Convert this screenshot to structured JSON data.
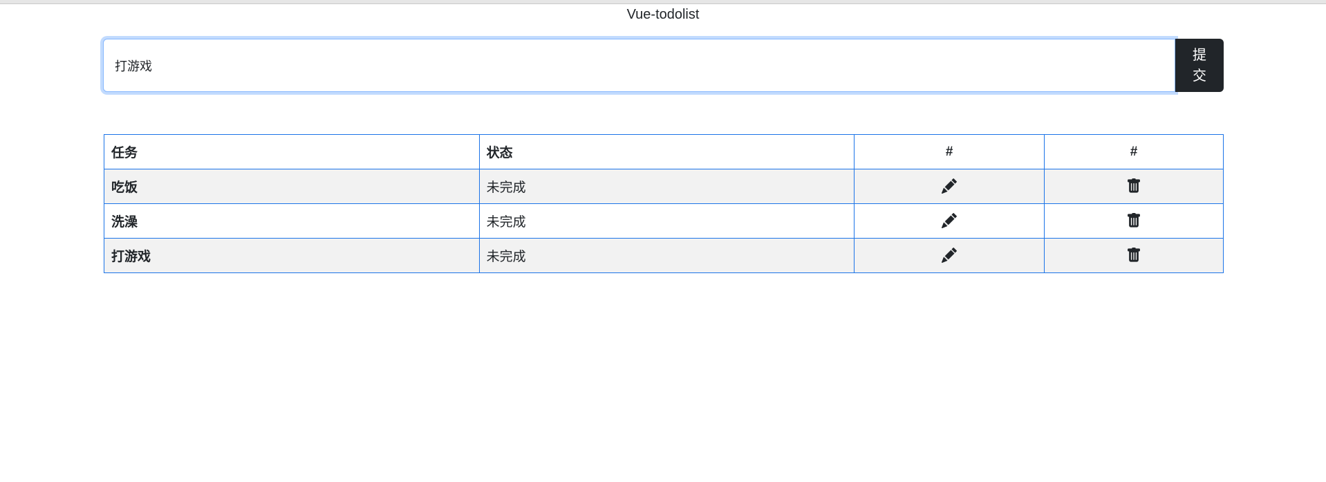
{
  "app": {
    "title": "Vue-todolist"
  },
  "form": {
    "input_value": "打游戏",
    "submit_label": "提交"
  },
  "table": {
    "headers": [
      "任务",
      "状态",
      "#",
      "#"
    ],
    "rows": [
      {
        "task": "吃饭",
        "status": "未完成",
        "edit_icon": "pencil-icon",
        "delete_icon": "trash-icon"
      },
      {
        "task": "洗澡",
        "status": "未完成",
        "edit_icon": "pencil-icon",
        "delete_icon": "trash-icon"
      },
      {
        "task": "打游戏",
        "status": "未完成",
        "edit_icon": "pencil-icon",
        "delete_icon": "trash-icon"
      }
    ]
  },
  "colors": {
    "accent_border": "#1a73e8",
    "focus_border": "#86b7fe",
    "button_bg": "#212529",
    "striped_row": "#f2f2f2"
  }
}
